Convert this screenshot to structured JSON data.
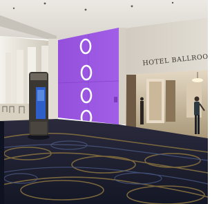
{
  "scene": {
    "description_free": true,
    "signage": {
      "ballrooms_sign": "HOTEL BALLROOMS"
    },
    "markers": {
      "count": 4,
      "color": "#ffffff"
    },
    "colors": {
      "accent_panel": "#9a55e0",
      "carpet": "#1e2236",
      "wall": "#ddd8cf",
      "ceiling": "#e6e3de",
      "hall_floor": "#b5a58c"
    }
  }
}
